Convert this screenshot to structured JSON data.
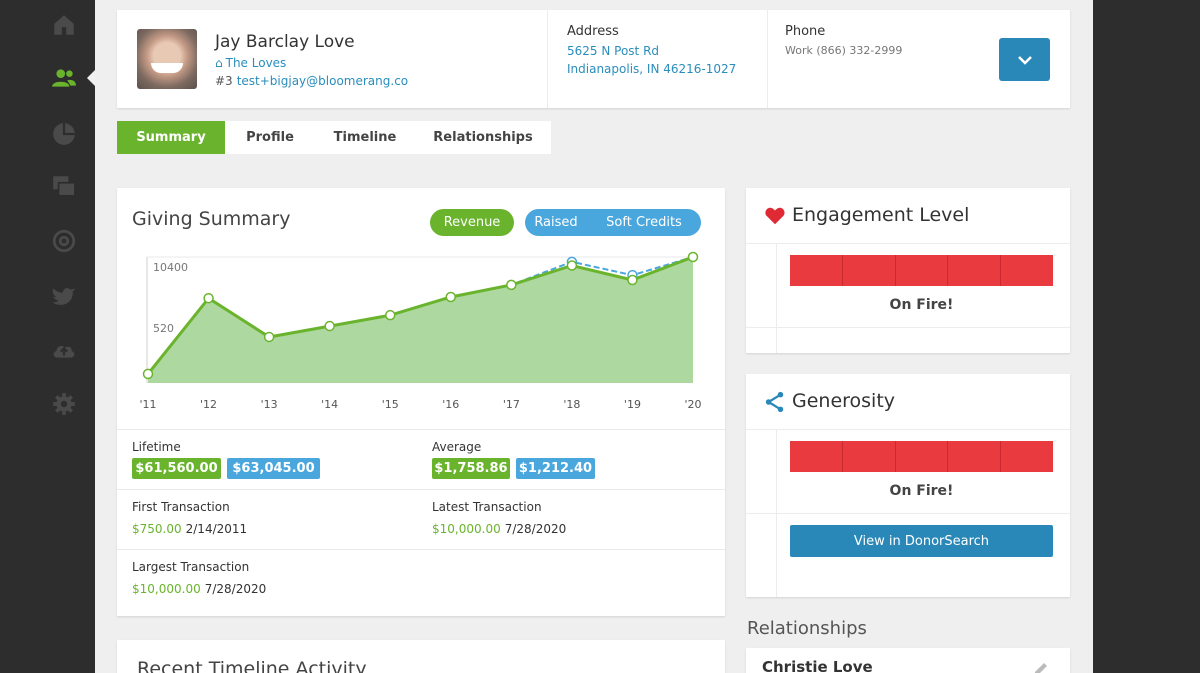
{
  "sidebar": {
    "items": [
      {
        "icon": "home-icon"
      },
      {
        "icon": "users-icon",
        "active": true
      },
      {
        "icon": "pie-chart-icon"
      },
      {
        "icon": "folders-icon"
      },
      {
        "icon": "at-icon"
      },
      {
        "icon": "twitter-icon"
      },
      {
        "icon": "cloud-upload-icon"
      },
      {
        "icon": "gear-icon"
      }
    ]
  },
  "header": {
    "name": "Jay Barclay Love",
    "household": "The Loves",
    "id": "#3",
    "email": "test+bigjay@bloomerang.co",
    "address_label": "Address",
    "address_line1": "5625 N Post Rd",
    "address_line2": "Indianapolis, IN 46216-1027",
    "phone_label": "Phone",
    "phone_value": "Work (866) 332-2999"
  },
  "tabs": [
    {
      "label": "Summary",
      "active": true
    },
    {
      "label": "Profile"
    },
    {
      "label": "Timeline"
    },
    {
      "label": "Relationships"
    }
  ],
  "giving_summary": {
    "title": "Giving Summary",
    "toggle_revenue": "Revenue",
    "toggle_raised": "Raised",
    "toggle_soft_credits": "Soft Credits",
    "lifetime_label": "Lifetime",
    "lifetime_revenue": "$61,560.00",
    "lifetime_raised": "$63,045.00",
    "average_label": "Average",
    "average_revenue": "$1,758.86",
    "average_raised": "$1,212.40",
    "first_label": "First Transaction",
    "first_amount": "$750.00",
    "first_date": "2/14/2011",
    "latest_label": "Latest Transaction",
    "latest_amount": "$10,000.00",
    "latest_date": "7/28/2020",
    "largest_label": "Largest Transaction",
    "largest_amount": "$10,000.00",
    "largest_date": "7/28/2020"
  },
  "chart_data": {
    "type": "area",
    "categories": [
      "'11",
      "'12",
      "'13",
      "'14",
      "'15",
      "'16",
      "'17",
      "'18",
      "'19",
      "'20"
    ],
    "series": [
      {
        "name": "Revenue",
        "values": [
          750,
          7000,
          3800,
          4700,
          5600,
          7100,
          8100,
          9700,
          8500,
          10400
        ]
      },
      {
        "name": "Raised",
        "values": [
          750,
          7000,
          3800,
          4700,
          5600,
          7100,
          8100,
          10000,
          8900,
          10400
        ]
      }
    ],
    "ytick_labels": [
      "10400",
      "520"
    ],
    "ylim": [
      0,
      10400
    ],
    "grid": false,
    "colors": {
      "revenue_line": "#6ab42d",
      "raised_line": "#4aa7dd",
      "area_fill": "#9fd18e"
    }
  },
  "timeline": {
    "title": "Recent Timeline Activity"
  },
  "engagement": {
    "title": "Engagement Level",
    "status": "On Fire!"
  },
  "generosity": {
    "title": "Generosity",
    "status": "On Fire!",
    "button_label": "View in DonorSearch"
  },
  "relationships": {
    "heading": "Relationships",
    "items": [
      {
        "name": "Christie Love"
      }
    ]
  },
  "colors": {
    "green": "#6ab42d",
    "blue": "#4aa7dd",
    "dark_blue": "#2a88b8",
    "red": "#e83a3f",
    "sidebar": "#2d2d2d"
  }
}
